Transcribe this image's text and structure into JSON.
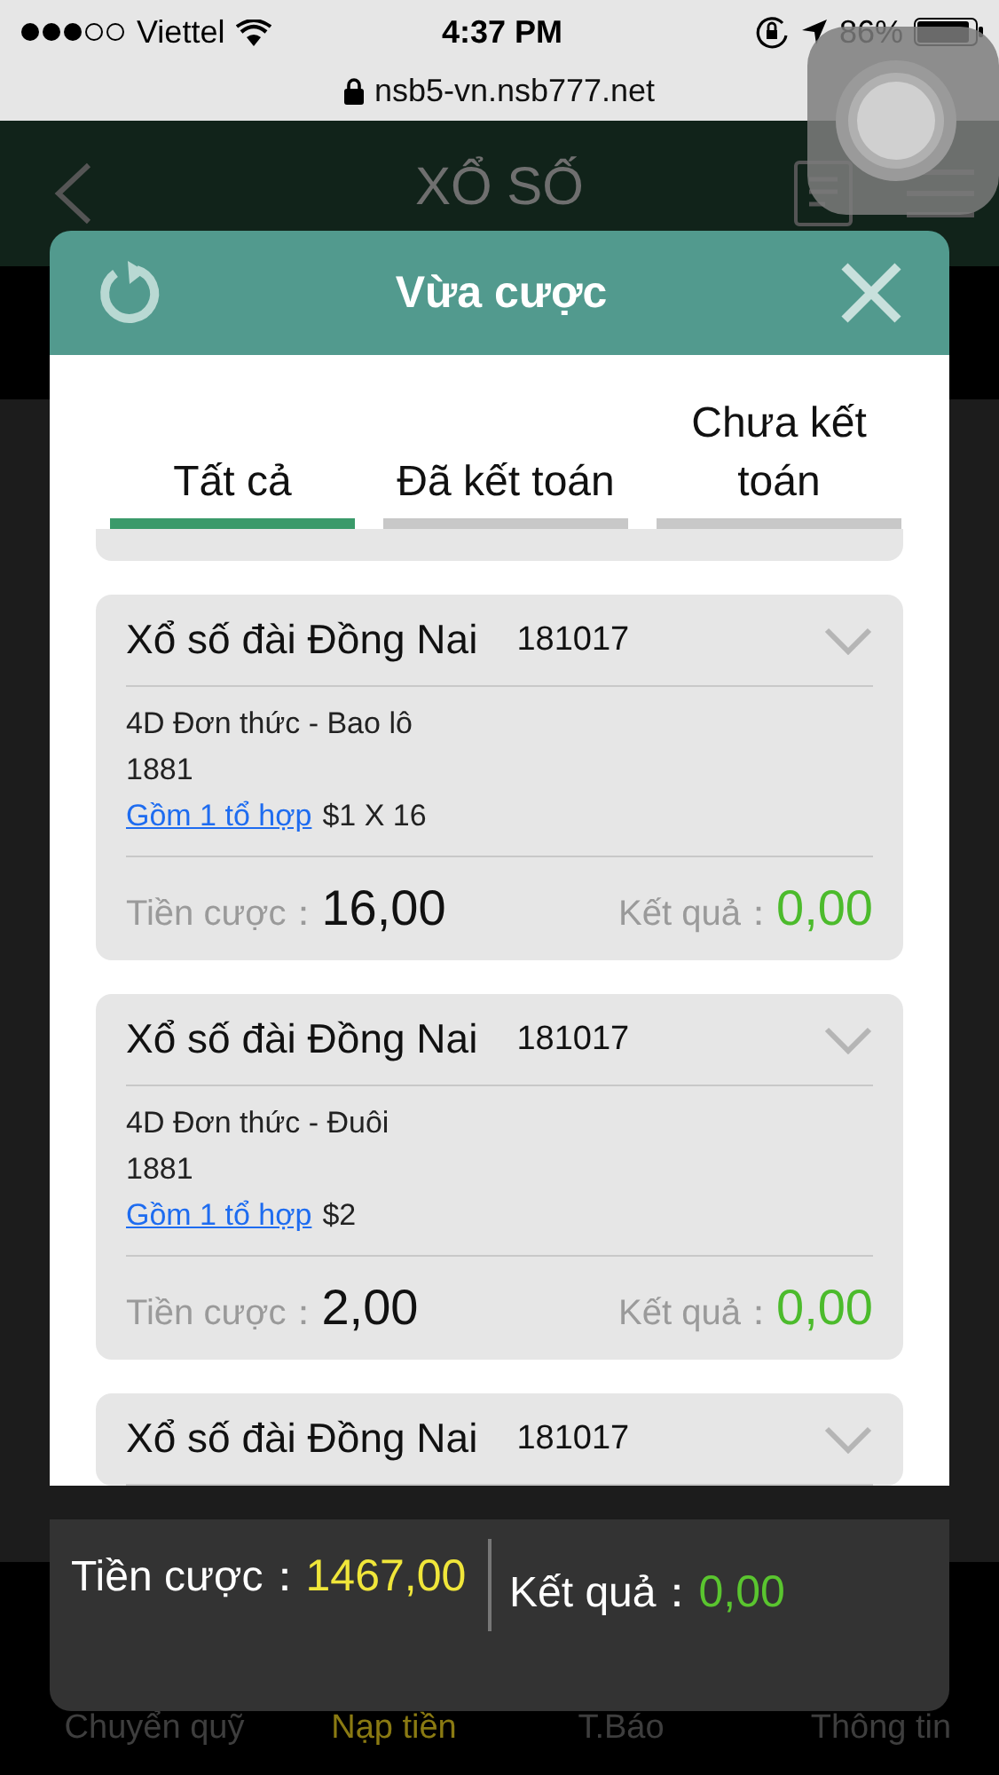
{
  "status_bar": {
    "carrier": "Viettel",
    "time": "4:37 PM",
    "battery": "86%"
  },
  "address_bar": {
    "url": "nsb5-vn.nsb777.net"
  },
  "app_header": {
    "title": "XỔ SỐ"
  },
  "dialog": {
    "title": "Vừa cược",
    "tabs": [
      {
        "label": "Tất cả",
        "selected": true
      },
      {
        "label": "Đã kết toán",
        "selected": false
      },
      {
        "label": "Chưa kết toán",
        "selected": false
      }
    ],
    "bets": [
      {
        "lottery": "Xổ số đài Đồng Nai",
        "draw": "181017",
        "bet_type": "4D Đơn thức - Bao lô",
        "number": "1881",
        "combo_link": "Gồm 1 tổ hợp",
        "amount": "$1 X 16",
        "stake_label": "Tiền cược：",
        "stake": "16,00",
        "result_label": "Kết quả：",
        "result": "0,00"
      },
      {
        "lottery": "Xổ số đài Đồng Nai",
        "draw": "181017",
        "bet_type": "4D Đơn thức - Đuôi",
        "number": "1881",
        "combo_link": "Gồm 1 tổ hợp",
        "amount": "$2",
        "stake_label": "Tiền cược：",
        "stake": "2,00",
        "result_label": "Kết quả：",
        "result": "0,00"
      },
      {
        "lottery": "Xổ số đài Đồng Nai",
        "draw": "181017"
      }
    ],
    "summary": {
      "stake_label": "Tiền cược：",
      "stake": "1467,00",
      "result_label": "Kết quả：",
      "result": "0,00"
    }
  },
  "bottom_nav": [
    {
      "label": "Chuyển quỹ",
      "selected": false
    },
    {
      "label": "Nạp tiền",
      "selected": true
    },
    {
      "label": "T.Báo",
      "selected": false
    },
    {
      "label": "Thông tin",
      "selected": false
    }
  ]
}
